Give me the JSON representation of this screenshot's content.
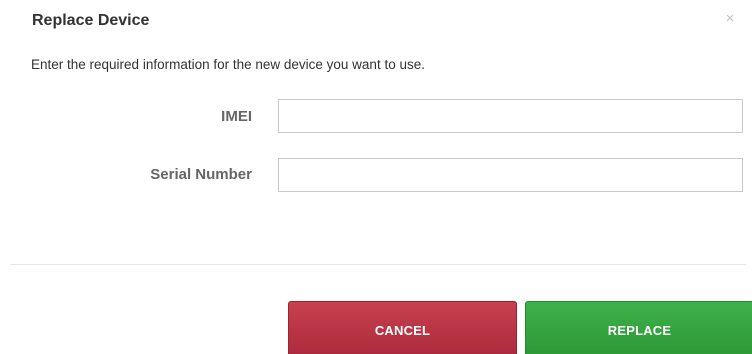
{
  "dialog": {
    "title": "Replace Device",
    "close_label": "×",
    "instruction": "Enter the required information for the new device you want to use.",
    "fields": {
      "imei": {
        "label": "IMEI",
        "value": "",
        "placeholder": ""
      },
      "serial": {
        "label": "Serial Number",
        "value": "",
        "placeholder": ""
      }
    },
    "buttons": {
      "cancel_label": "CANCEL",
      "replace_label": "REPLACE"
    }
  },
  "colors": {
    "cancel": "#b83343",
    "replace": "#35a43f",
    "label": "#666666",
    "close_icon": "#c0c0c0"
  }
}
